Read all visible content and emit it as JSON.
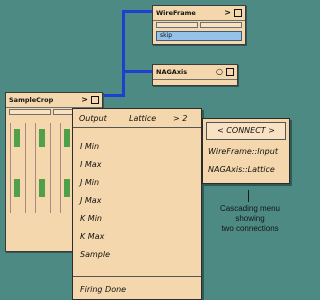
{
  "modules": {
    "wireframe": {
      "title": "WireFrame",
      "ctrl": ">",
      "param_value": "skip"
    },
    "nagaxis": {
      "title": "NAGAxis",
      "ctrl": "○"
    },
    "samplecrop": {
      "title": "SampleCrop",
      "ctrl": ">"
    }
  },
  "port_menu": {
    "header_left": "Output",
    "header_mid": "Lattice",
    "header_right": "> 2",
    "items": [
      "I Min",
      "I Max",
      "J Min",
      "J Max",
      "K Min",
      "K Max",
      "Sample"
    ],
    "footer": "Firing Done"
  },
  "connect_menu": {
    "header": "< CONNECT >",
    "items": [
      "WireFrame::Input",
      "NAGAxis::Lattice"
    ]
  },
  "caption": {
    "line1": "Cascading menu",
    "line2": "showing",
    "line3": "two connections"
  },
  "colors": {
    "background": "#4e8a84",
    "wire": "#1f3fd0",
    "module_face": "#f4d7ad",
    "param_field": "#95c2e8",
    "column_marker": "#4fa048"
  }
}
